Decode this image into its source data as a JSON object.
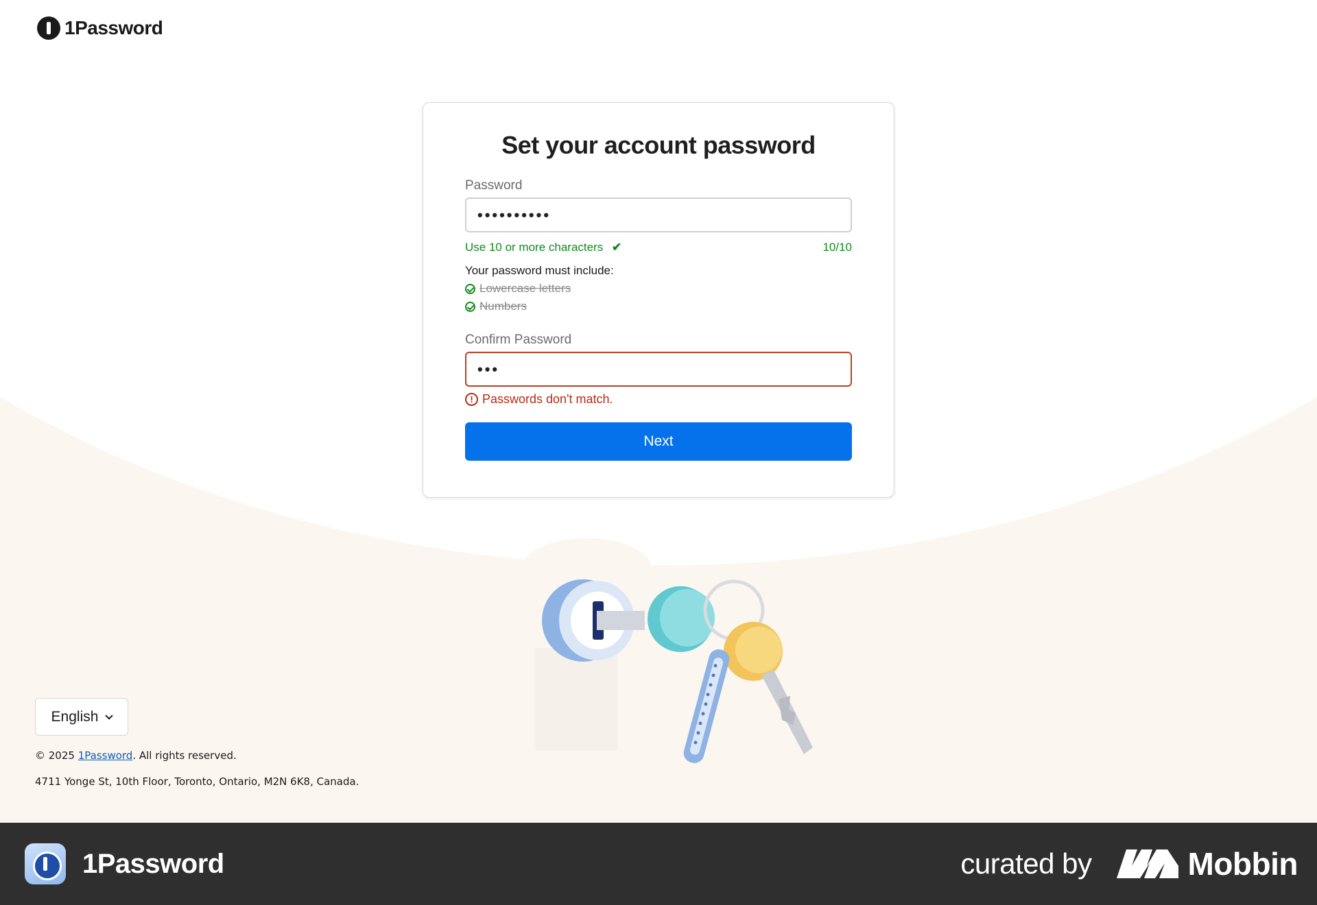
{
  "header": {
    "logo_text": "1Password"
  },
  "card": {
    "title": "Set your account password",
    "password_label": "Password",
    "password_value": "••••••••••",
    "length_rule": "Use 10 or more characters",
    "length_count": "10/10",
    "must_include": "Your password must include:",
    "requirements": [
      "Lowercase letters",
      "Numbers"
    ],
    "confirm_label": "Confirm Password",
    "confirm_value": "•••",
    "error_text": "Passwords don't match.",
    "next_label": "Next"
  },
  "footer": {
    "language": "English",
    "copyright_prefix": "© 2025 ",
    "copyright_link": "1Password",
    "copyright_suffix": ". All rights reserved.",
    "address": "4711 Yonge St, 10th Floor, Toronto, Ontario, M2N 6K8, Canada."
  },
  "brandbar": {
    "app_name": "1Password",
    "curated_by": "curated by",
    "mobbin": "Mobbin"
  },
  "colors": {
    "primary_button": "#0572ec",
    "success": "#138a1e",
    "error": "#b52d12",
    "background_cream": "#fbf6f0"
  },
  "icons": [
    "onepassword-logo-icon",
    "checkmark-icon",
    "check-circle-icon",
    "error-circle-icon",
    "chevron-down-icon",
    "key-illustration",
    "mobbin-logo-icon"
  ]
}
